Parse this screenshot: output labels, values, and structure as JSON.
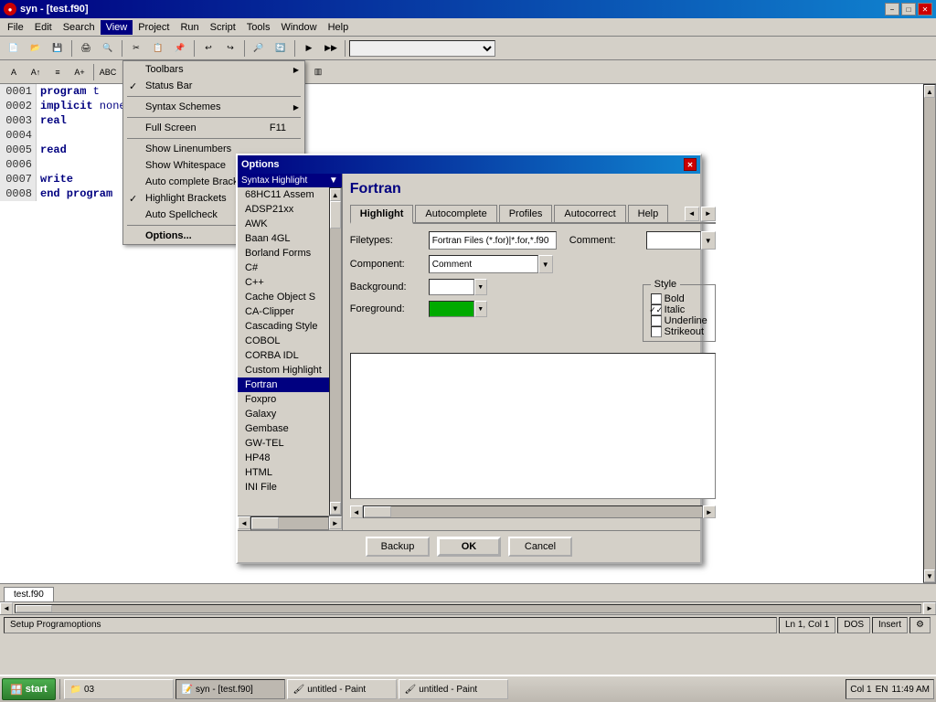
{
  "window": {
    "title": "syn - [test.f90]",
    "app_icon": "●",
    "controls": [
      "−",
      "□",
      "✕"
    ]
  },
  "menu": {
    "items": [
      "File",
      "Edit",
      "Search",
      "View",
      "Project",
      "Run",
      "Script",
      "Tools",
      "Window",
      "Help"
    ]
  },
  "view_menu": {
    "items": [
      {
        "label": "Toolbars",
        "has_sub": true,
        "checked": false
      },
      {
        "label": "Status Bar",
        "has_sub": false,
        "checked": true
      },
      {
        "separator_after": true
      },
      {
        "label": "Syntax Schemes",
        "has_sub": true,
        "checked": false
      },
      {
        "separator_after": true
      },
      {
        "label": "Full Screen",
        "shortcut": "F11",
        "has_sub": false,
        "checked": false
      },
      {
        "separator_after": true
      },
      {
        "label": "Show Linenumbers",
        "has_sub": false,
        "checked": false
      },
      {
        "label": "Show Whitespace",
        "has_sub": false,
        "checked": false
      },
      {
        "label": "Auto complete Brack...",
        "has_sub": false,
        "checked": false
      },
      {
        "label": "Highlight Brackets",
        "has_sub": false,
        "checked": true
      },
      {
        "label": "Auto Spellcheck",
        "has_sub": false,
        "checked": false
      },
      {
        "separator_after": true
      },
      {
        "label": "Options...",
        "has_sub": false,
        "checked": false
      }
    ]
  },
  "editor": {
    "lines": [
      {
        "num": "0001",
        "code": "program t"
      },
      {
        "num": "0002",
        "code": "  implicit none"
      },
      {
        "num": "0003",
        "code": "    real"
      },
      {
        "num": "0004",
        "code": ""
      },
      {
        "num": "0005",
        "code": "  read"
      },
      {
        "num": "0006",
        "code": ""
      },
      {
        "num": "0007",
        "code": "  write"
      },
      {
        "num": "0008",
        "code": "end program"
      }
    ],
    "tab": "test.f90"
  },
  "options_dialog": {
    "title": "Options",
    "language_header": "Syntax Highlight",
    "selected_language": "Fortran",
    "languages": [
      "68HC11 Assem",
      "ADSP21xx",
      "AWK",
      "Baan 4GL",
      "Borland Forms",
      "C#",
      "C++",
      "Cache Object S",
      "CA-Clipper",
      "Cascading Style",
      "COBOL",
      "CORBA IDL",
      "Custom Highlight",
      "Fortran",
      "Foxpro",
      "Galaxy",
      "Gembase",
      "GW-TEL",
      "HP48",
      "HTML",
      "INI File"
    ],
    "right_title": "Fortran",
    "tabs": [
      "Highlight",
      "Autocomplete",
      "Profiles",
      "Autocorrect",
      "Help"
    ],
    "active_tab": "Highlight",
    "filetypes_label": "Filetypes:",
    "filetypes_value": "Fortran Files (*.for)|*.for,*.f90",
    "comment_label": "Comment:",
    "comment_value": "",
    "component_label": "Component:",
    "component_value": "Comment",
    "style": {
      "label": "Style",
      "bold": {
        "label": "Bold",
        "checked": false
      },
      "italic": {
        "label": "Italic",
        "checked": true
      },
      "underline": {
        "label": "Underline",
        "checked": false
      },
      "strikeout": {
        "label": "Strikeout",
        "checked": false
      }
    },
    "background_label": "Background:",
    "foreground_label": "Foreground:",
    "background_color": "white",
    "foreground_color": "green",
    "buttons": {
      "backup": "Backup",
      "ok": "OK",
      "cancel": "Cancel"
    }
  },
  "status_bar": {
    "setup": "Setup Programoptions",
    "position": "Ln 1, Col 1",
    "mode": "DOS",
    "insert": "Insert",
    "icon": "⚙"
  },
  "taskbar": {
    "start_label": "start",
    "time": "11:49 AM",
    "lang": "EN",
    "apps": [
      {
        "label": "03",
        "icon": "📁"
      },
      {
        "label": "syn - [test.f90]",
        "icon": "📝",
        "active": true
      },
      {
        "label": "untitled - Paint",
        "icon": "🖌",
        "active": false
      },
      {
        "label": "untitled - Paint",
        "icon": "🖌",
        "active": false
      }
    ],
    "col_label": "Col 1"
  }
}
